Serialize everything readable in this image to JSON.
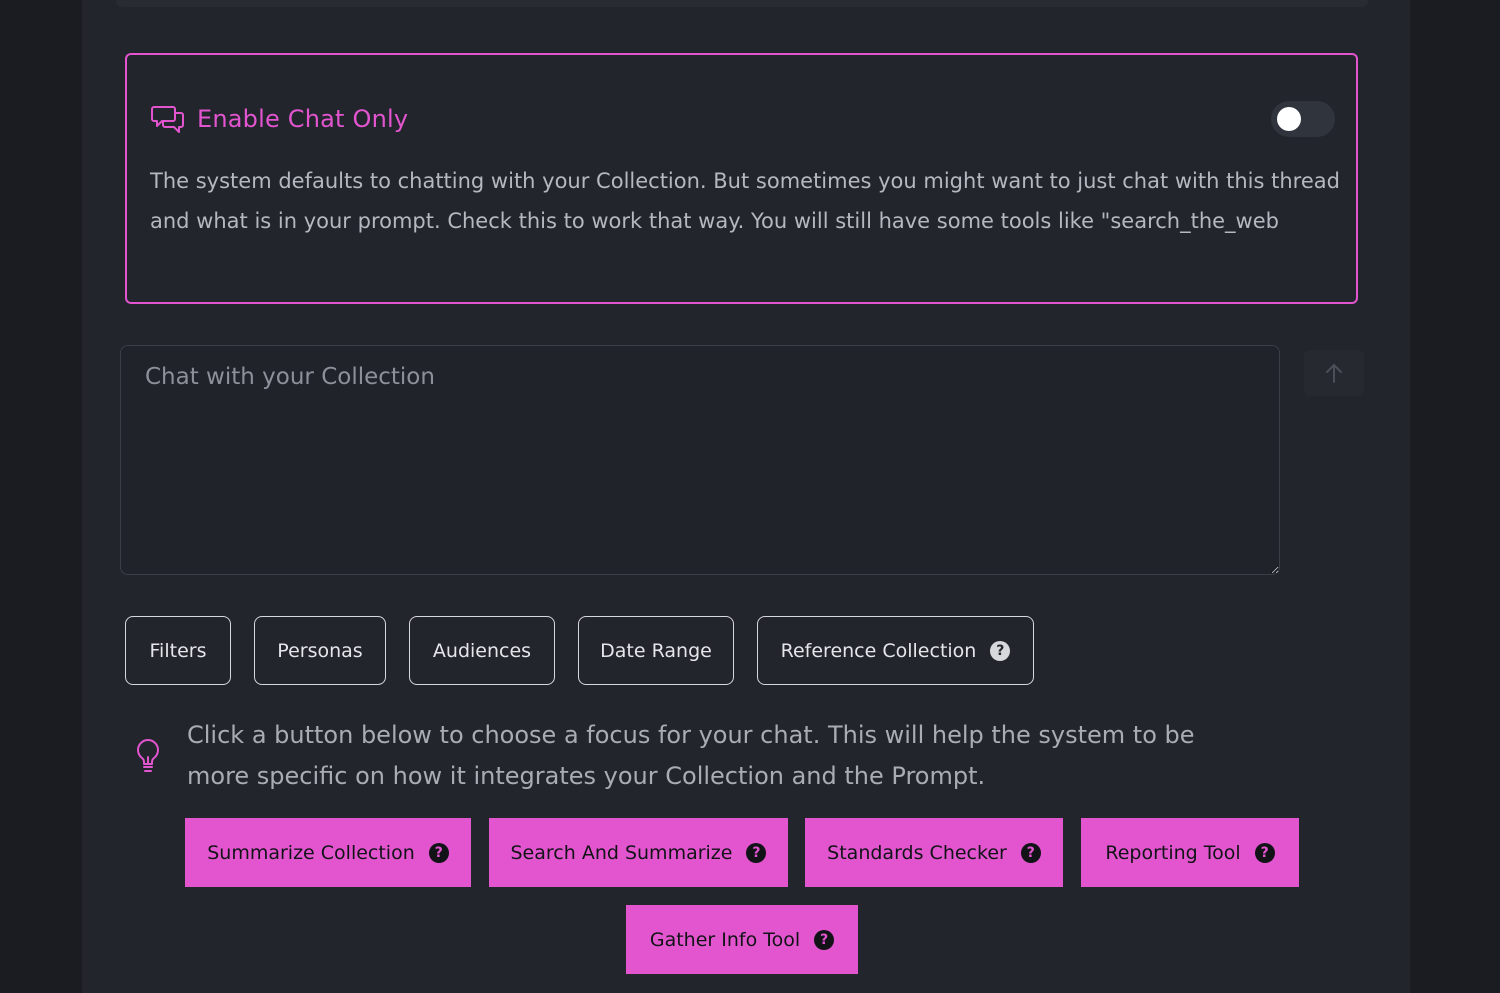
{
  "chat_only": {
    "title": "Enable Chat Only",
    "description": "The system defaults to chatting with your Collection. But sometimes you might want to just chat with this thread and what is in your prompt. Check this to work that way. You will still have some tools like \"search_the_web",
    "toggle_on": false
  },
  "chat_input": {
    "placeholder": "Chat with your Collection",
    "value": ""
  },
  "options": {
    "filters": "Filters",
    "personas": "Personas",
    "audiences": "Audiences",
    "date_range": "Date Range",
    "reference_collection": "Reference Collection"
  },
  "tip": {
    "text": "Click a button below to choose a focus for your chat. This will help the system to be more specific on how it integrates your Collection and the Prompt."
  },
  "focus_buttons": {
    "summarize_collection": "Summarize Collection",
    "search_and_summarize": "Search And Summarize",
    "standards_checker": "Standards Checker",
    "reporting_tool": "Reporting Tool",
    "gather_info_tool": "Gather Info Tool"
  },
  "help_glyph": "?",
  "colors": {
    "accent": "#e255cf",
    "background": "#22252c",
    "outer_background": "#1a1c21"
  },
  "icons": {
    "chat": "chat-bubbles-icon",
    "send": "arrow-up-icon",
    "tip": "lightbulb-icon",
    "help": "question-circle-icon"
  }
}
